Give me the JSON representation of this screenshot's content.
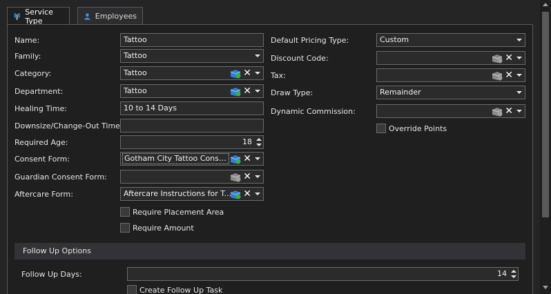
{
  "tabs": [
    {
      "label": "Service Type",
      "icon": "service-type-icon",
      "active": true
    },
    {
      "label": "Employees",
      "icon": "user-icon",
      "active": false
    }
  ],
  "left": {
    "name": {
      "label": "Name:",
      "value": "Tattoo"
    },
    "family": {
      "label": "Family:",
      "value": "Tattoo"
    },
    "category": {
      "label": "Category:",
      "value": "Tattoo"
    },
    "department": {
      "label": "Department:",
      "value": "Tattoo"
    },
    "healing_time": {
      "label": "Healing Time:",
      "value": "10 to 14 Days"
    },
    "downsize": {
      "label": "Downsize/Change-Out Time:",
      "value": ""
    },
    "required_age": {
      "label": "Required Age:",
      "value": "18"
    },
    "consent_form": {
      "label": "Consent Form:",
      "value": "Gotham City Tattoo Consen..."
    },
    "guardian_consent": {
      "label": "Guardian Consent Form:",
      "value": ""
    },
    "aftercare_form": {
      "label": "Aftercare Form:",
      "value": "Aftercare Instructions for T..."
    },
    "require_placement": {
      "label": "Require Placement Area",
      "checked": false
    },
    "require_amount": {
      "label": "Require Amount",
      "checked": false
    }
  },
  "right": {
    "default_pricing": {
      "label": "Default Pricing Type:",
      "value": "Custom"
    },
    "discount_code": {
      "label": "Discount Code:",
      "value": ""
    },
    "tax": {
      "label": "Tax:",
      "value": ""
    },
    "draw_type": {
      "label": "Draw Type:",
      "value": "Remainder"
    },
    "dynamic_commission": {
      "label": "Dynamic Commission:",
      "value": ""
    },
    "override_points": {
      "label": "Override Points",
      "checked": false
    }
  },
  "follow_up": {
    "section_title": "Follow Up Options",
    "days": {
      "label": "Follow Up Days:",
      "value": "14"
    },
    "create_task": {
      "label": "Create Follow Up Task",
      "checked": false
    }
  },
  "colors": {
    "accent_blue": "#2f7fd6",
    "accent_green": "#3cae49",
    "background": "#1f1f1f"
  }
}
